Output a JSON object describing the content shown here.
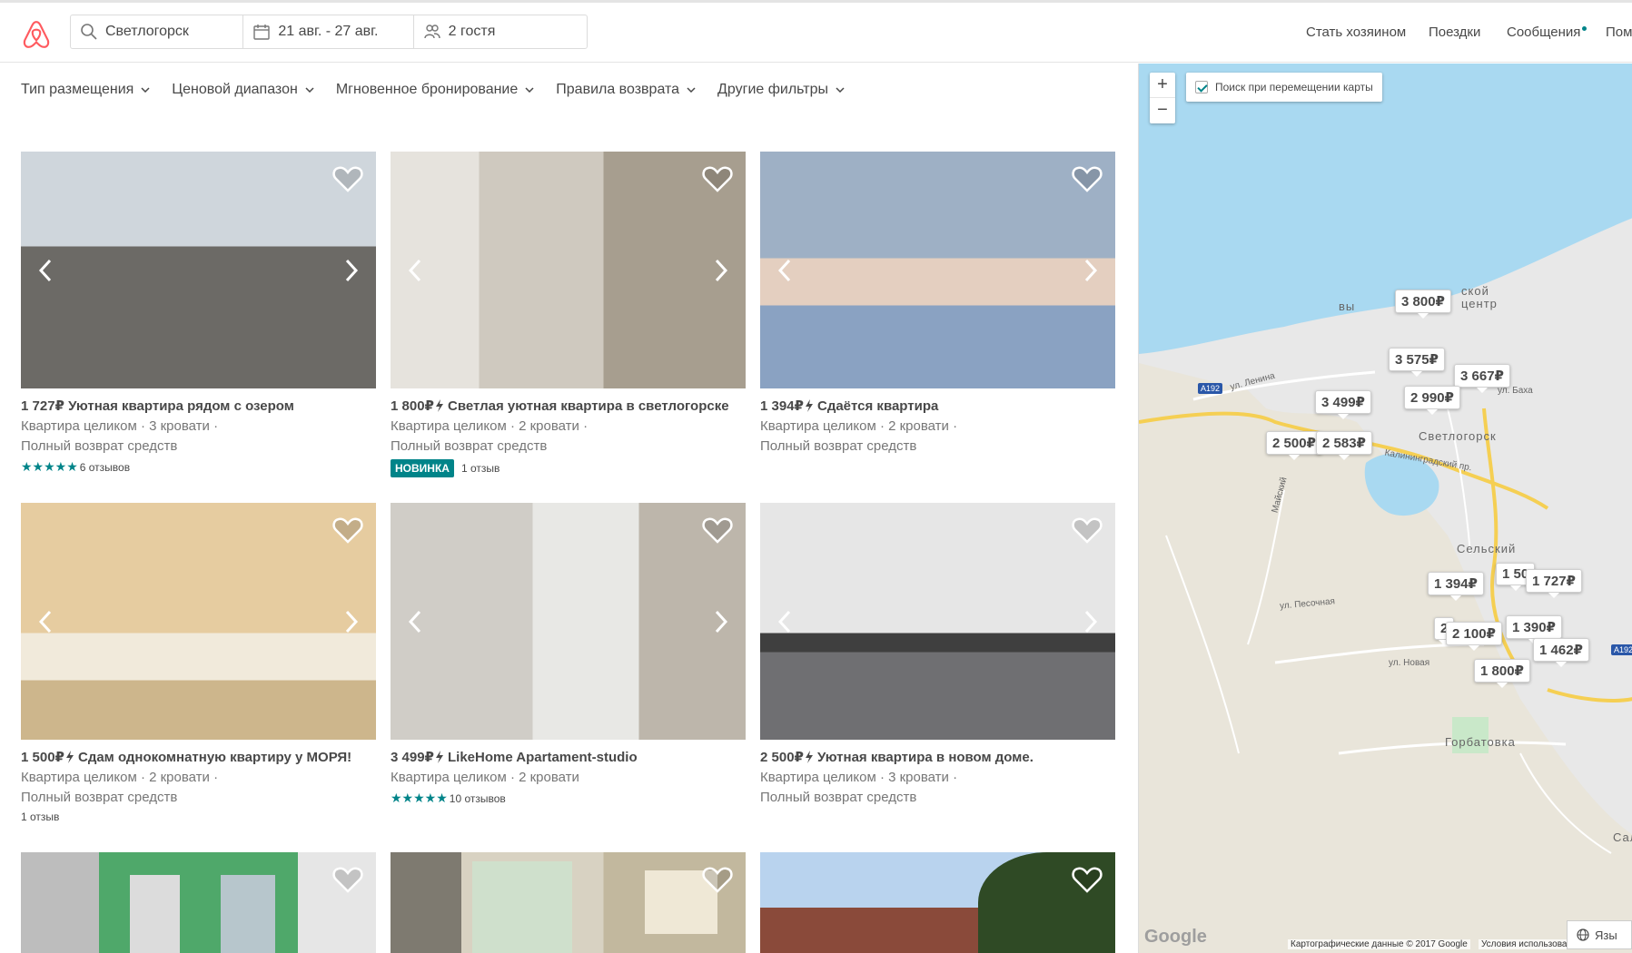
{
  "header": {
    "search": {
      "location": "Светлогорск",
      "dates": "21 авг. - 27 авг.",
      "guests": "2 гостя"
    },
    "nav": {
      "host": "Стать хозяином",
      "trips": "Поездки",
      "messages": "Сообщения",
      "help": "Пом"
    }
  },
  "filters": [
    "Тип размещения",
    "Ценовой диапазон",
    "Мгновенное бронирование",
    "Правила возврата",
    "Другие фильтры"
  ],
  "listings": [
    {
      "price": "1 727₽",
      "instant": false,
      "title": "Уютная квартира рядом с озером",
      "details": "Квартира целиком · 3 кровати ·",
      "policy": "Полный возврат средств",
      "stars": "★★★★★",
      "reviews": "6 отзывов",
      "badge": ""
    },
    {
      "price": "1 800₽",
      "instant": true,
      "title": "Светлая уютная квартира в светлогорске",
      "details": "Квартира целиком · 2 кровати ·",
      "policy": "Полный возврат средств",
      "stars": "",
      "reviews": "1 отзыв",
      "badge": "НОВИНКА"
    },
    {
      "price": "1 394₽",
      "instant": true,
      "title": "Сдаётся квартира",
      "details": "Квартира целиком · 2 кровати ·",
      "policy": "Полный возврат средств",
      "stars": "",
      "reviews": "",
      "badge": ""
    },
    {
      "price": "1 500₽",
      "instant": true,
      "title": "Сдам однокомнатную квартиру у МОРЯ!",
      "details": "Квартира целиком · 2 кровати ·",
      "policy": "Полный возврат средств",
      "stars": "",
      "reviews": "1 отзыв",
      "badge": ""
    },
    {
      "price": "3 499₽",
      "instant": true,
      "title": "LikeHome Apartament-studio",
      "details": "Квартира целиком · 2 кровати",
      "policy": "",
      "stars": "★★★★★",
      "reviews": "10 отзывов",
      "badge": ""
    },
    {
      "price": "2 500₽",
      "instant": true,
      "title": "Уютная квартира в новом доме.",
      "details": "Квартира целиком · 3 кровати ·",
      "policy": "Полный возврат средств",
      "stars": "",
      "reviews": "",
      "badge": ""
    }
  ],
  "map": {
    "search_when_moving": "Поиск при перемещении карты",
    "zoom_in": "+",
    "zoom_out": "−",
    "pins": [
      "3 800₽",
      "3 575₽",
      "3 667₽",
      "3 499₽",
      "2 990₽",
      "2 500₽",
      "2 583₽",
      "1 394₽",
      "1 50",
      "1 727₽",
      "2",
      "2 100₽",
      "1 390₽",
      "1 462₽",
      "1 800₽"
    ],
    "labels": {
      "city": "Светлогорск",
      "village1": "Сельский",
      "village2": "Горбатовка",
      "center": "ской центр",
      "sal": "Сал",
      "avenue": "Калининградский пр.",
      "lenina": "ул. Ленина",
      "pesochnaya": "ул. Песочная",
      "novaya": "ул. Новая",
      "maiskiy": "Майский",
      "baha": "ул. Баха",
      "vy": "вы",
      "road1": "A192",
      "road2": "A192"
    },
    "google": "Google",
    "copyright": "Картографические данные © 2017 Google",
    "terms": "Условия использования",
    "language": "Язы"
  },
  "colors": {
    "brand": "#FF5A5F",
    "teal": "#008489",
    "water": "#a9d9f1"
  }
}
